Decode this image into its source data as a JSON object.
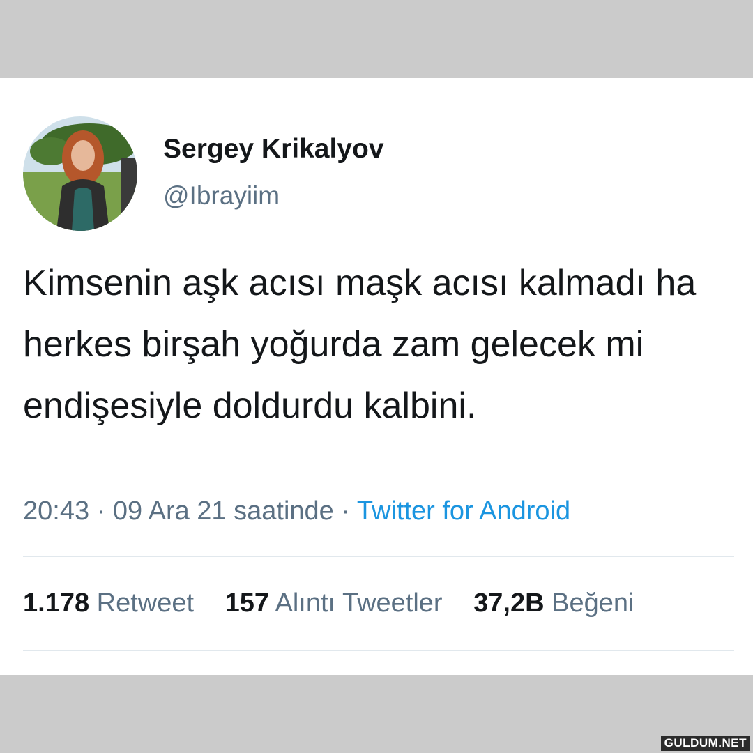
{
  "tweet": {
    "display_name": "Sergey Krikalyov",
    "handle": "@Ibrayiim",
    "text": "Kimsenin aşk acısı maşk acısı kalmadı ha herkes birşah yoğurda zam gelecek mi endişesiyle doldurdu kalbini.",
    "time": "20:43",
    "date": "09 Ara 21 saatinde",
    "separator": "·",
    "source": "Twitter for Android",
    "avatar": "profile-photo"
  },
  "stats": {
    "retweets_count": "1.178",
    "retweets_label": "Retweet",
    "quotes_count": "157",
    "quotes_label": "Alıntı Tweetler",
    "likes_count": "37,2B",
    "likes_label": "Beğeni"
  },
  "watermark": "GULDUM.NET",
  "colors": {
    "background": "#cbcbcb",
    "card": "#ffffff",
    "text": "#14171a",
    "secondary": "#5b7083",
    "link": "#1b95e0"
  }
}
